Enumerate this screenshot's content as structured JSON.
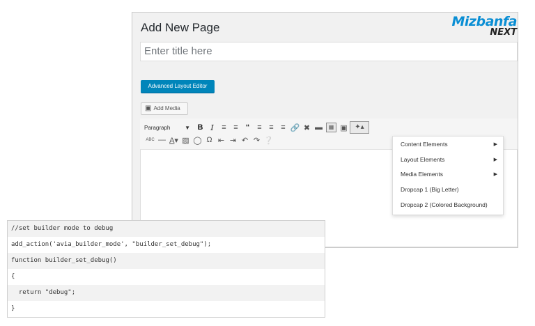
{
  "page": {
    "title": "Add New Page",
    "title_placeholder": "Enter title here"
  },
  "logo": {
    "brand": "Mizbanfa",
    "sub": "NEXT",
    "color": "#0a8ed4"
  },
  "buttons": {
    "advanced_layout_editor": "Advanced Layout Editor",
    "add_media": "Add Media"
  },
  "toolbar": {
    "format_select": "Paragraph",
    "row1_icons": [
      "bold-icon",
      "italic-icon",
      "bullet-list-icon",
      "numbered-list-icon",
      "blockquote-icon",
      "align-left-icon",
      "align-center-icon",
      "align-right-icon",
      "link-icon",
      "unlink-icon",
      "read-more-icon",
      "toolbar-toggle-icon",
      "image-icon",
      "shortcode-wand-icon"
    ],
    "row2_icons": [
      "strikethrough-icon",
      "horizontal-line-icon",
      "text-color-icon",
      "paste-text-icon",
      "clear-formatting-icon",
      "special-character-icon",
      "outdent-icon",
      "indent-icon",
      "undo-icon",
      "redo-icon",
      "help-icon"
    ]
  },
  "dropdown": {
    "items": [
      {
        "label": "Content Elements",
        "has_submenu": true
      },
      {
        "label": "Layout Elements",
        "has_submenu": true
      },
      {
        "label": "Media Elements",
        "has_submenu": true
      },
      {
        "label": "Dropcap 1 (Big Letter)",
        "has_submenu": false
      },
      {
        "label": "Dropcap 2 (Colored Background)",
        "has_submenu": false
      }
    ]
  },
  "code": {
    "lines": [
      "//set builder mode to debug",
      "add_action('avia_builder_mode', \"builder_set_debug\");",
      "function builder_set_debug()",
      "{",
      "  return \"debug\";",
      "}"
    ]
  }
}
